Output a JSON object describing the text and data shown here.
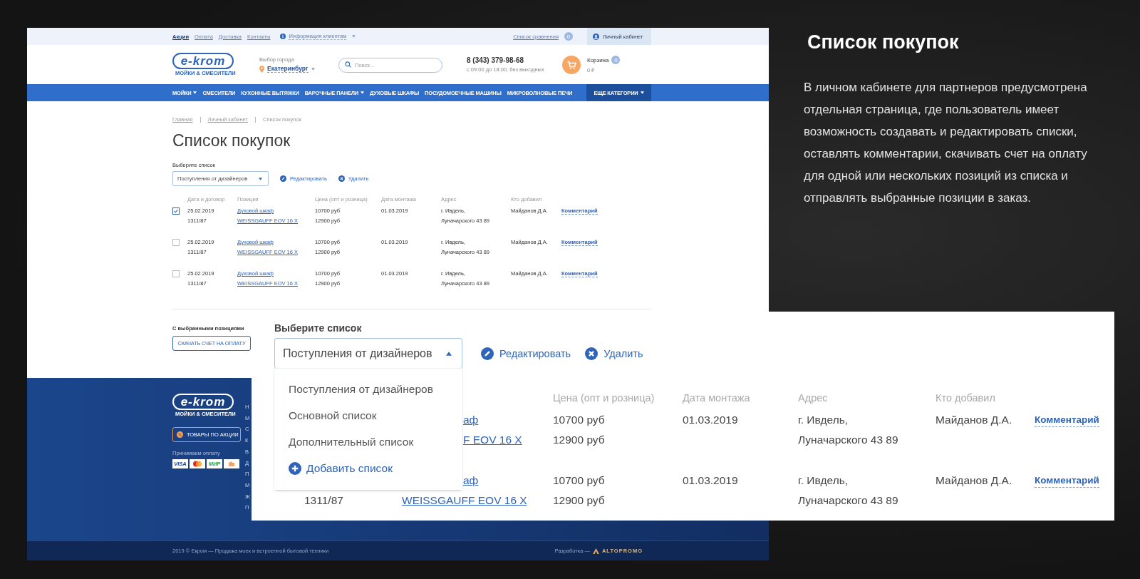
{
  "top_bar": {
    "links": [
      {
        "label": "Акции",
        "selected": true
      },
      {
        "label": "Оплата",
        "selected": false
      },
      {
        "label": "Доставка",
        "selected": false
      },
      {
        "label": "Контакты",
        "selected": false
      }
    ],
    "info_menu": "Информация клиентам",
    "compare": {
      "label": "Список сравнения",
      "count": "0"
    },
    "account": "Личный кабинет"
  },
  "header": {
    "logo": {
      "name": "e-krom",
      "tagline": "МОЙКИ & СМЕСИТЕЛИ"
    },
    "city": {
      "label": "Выбор города",
      "value": "Екатеринбург"
    },
    "search": {
      "placeholder": "Поиск..."
    },
    "phone": "8 (343) 379-98-68",
    "hours": "с 09:00 до 18:00, без выходных",
    "cart": {
      "label": "Корзина",
      "count": "0",
      "total": "0 ₽"
    }
  },
  "nav": [
    {
      "label": "МОЙКИ",
      "has_menu": true,
      "kind": "link"
    },
    {
      "label": "СМЕСИТЕЛИ",
      "has_menu": false,
      "kind": "link"
    },
    {
      "label": "КУХОННЫЕ ВЫТЯЖКИ",
      "has_menu": false,
      "kind": "link"
    },
    {
      "label": "ВАРОЧНЫЕ ПАНЕЛИ",
      "has_menu": true,
      "kind": "link"
    },
    {
      "label": "ДУХОВЫЕ ШКАФЫ",
      "has_menu": false,
      "kind": "link"
    },
    {
      "label": "ПОСУДОМОЕЧНЫЕ МАШИНЫ",
      "has_menu": false,
      "kind": "link"
    },
    {
      "label": "МИКРОВОЛНОВЫЕ ПЕЧИ",
      "has_menu": false,
      "kind": "link"
    },
    {
      "label": "ЕЩЕ КАТЕГОРИИ",
      "has_menu": true,
      "kind": "highlight"
    }
  ],
  "breadcrumbs": [
    {
      "label": "Главная",
      "kind": "link"
    },
    {
      "label": "Личный кабинет",
      "kind": "link"
    },
    {
      "label": "Список покупок",
      "kind": "current"
    }
  ],
  "page_title": "Список покупок",
  "list_picker": {
    "label": "Выберите список",
    "value": "Поступления от дизайнеров",
    "expanded": false,
    "actions": [
      {
        "label": "Редактировать",
        "kind": "edit"
      },
      {
        "label": "Удалить",
        "kind": "delete"
      }
    ]
  },
  "table": {
    "columns": [
      "Дата и договор",
      "Позиция",
      "Цена (опт и розница)",
      "Дата монтажа",
      "Адрес",
      "Кто добавил"
    ],
    "rows": [
      {
        "checked": true,
        "date": "25.02.2019",
        "contract": "1311/87",
        "position_name": "Духовой шкаф",
        "position_model": "WEISSGAUFF EOV 16 X",
        "price_wholesale": "10700 руб",
        "price_retail": "12900 руб",
        "mount_date": "01.03.2019",
        "address_line1": "г. Ивдель,",
        "address_line2": "Луначарского 43 89",
        "added_by": "Майданов Д.А.",
        "comment": "Комментарий"
      },
      {
        "checked": false,
        "date": "25.02.2019",
        "contract": "1311/87",
        "position_name": "Духовой шкаф",
        "position_model": "WEISSGAUFF EOV 16 X",
        "price_wholesale": "10700 руб",
        "price_retail": "12900 руб",
        "mount_date": "01.03.2019",
        "address_line1": "г. Ивдель,",
        "address_line2": "Луначарского 43 89",
        "added_by": "Майданов Д.А.",
        "comment": "Комментарий"
      },
      {
        "checked": false,
        "date": "25.02.2019",
        "contract": "1311/87",
        "position_name": "Духовой шкаф",
        "position_model": "WEISSGAUFF EOV 16 X",
        "price_wholesale": "10700 руб",
        "price_retail": "12900 руб",
        "mount_date": "01.03.2019",
        "address_line1": "г. Ивдель,",
        "address_line2": "Луначарского 43 89",
        "added_by": "Майданов Д.А.",
        "comment": "Комментарий"
      }
    ]
  },
  "selection_actions": {
    "label": "С выбранными позициями",
    "button": "СКАЧАТЬ СЧЕТ НА ОПЛАТУ"
  },
  "footer": {
    "logo": {
      "name": "e-krom",
      "tagline": "МОЙКИ & СМЕСИТЕЛИ"
    },
    "promo_button": "ТОВАРЫ ПО АКЦИИ",
    "payment_label": "Принимаем оплату",
    "payment_methods": [
      {
        "kind": "visa",
        "label": "VISA"
      },
      {
        "kind": "mastercard"
      },
      {
        "kind": "mir",
        "label": "МИР"
      },
      {
        "kind": "wallet"
      }
    ],
    "menu_fragments": [
      "Н",
      "М",
      "С",
      "К",
      "В",
      "Д",
      "П",
      "М",
      "Ж",
      "П"
    ],
    "copyright": "2019 © Екром — Продажа моек и встроенной бытовой техники",
    "developer": {
      "label": "Разработка —",
      "name": "ALTOPROMO"
    }
  },
  "zoom_panel": {
    "list_picker": {
      "label": "Выберите список",
      "value": "Поступления от дизайнеров",
      "expanded": true,
      "actions": [
        {
          "label": "Редактировать",
          "kind": "edit"
        },
        {
          "label": "Удалить",
          "kind": "delete"
        }
      ],
      "options": [
        {
          "label": "Поступления от дизайнеров",
          "kind": "option"
        },
        {
          "label": "Основной список",
          "kind": "option"
        },
        {
          "label": "Дополнительный список",
          "kind": "option"
        },
        {
          "label": "Добавить список",
          "kind": "add"
        }
      ]
    },
    "table": {
      "columns": [
        "Цена (опт и розница)",
        "Дата монтажа",
        "Адрес",
        "Кто добавил"
      ],
      "rows": [
        {
          "position_name": "аф",
          "position_model": "F EOV 16 X",
          "price_wholesale": "10700 руб",
          "price_retail": "12900 руб",
          "mount_date": "01.03.2019",
          "address_line1": "г. Ивдель,",
          "address_line2": "Луначарского 43 89",
          "added_by": "Майданов Д.А.",
          "comment": "Комментарий"
        },
        {
          "contract": "1311/87",
          "position_name": "аф",
          "position_model": "WEISSGAUFF EOV 16 X",
          "price_wholesale": "10700 руб",
          "price_retail": "12900 руб",
          "mount_date": "01.03.2019",
          "address_line1": "г. Ивдель,",
          "address_line2": "Луначарского 43 89",
          "added_by": "Майданов Д.А.",
          "comment": "Комментарий"
        }
      ]
    }
  },
  "description": {
    "title": "Список покупок",
    "text": "В личном кабинете для партнеров предусмотрена отдельная страница, где пользователь имеет возможность создавать и редактировать списки, оставлять комментарии, скачивать счет на оплату для одной или нескольких позиций из списка и отправлять выбранные позиции в заказ."
  }
}
